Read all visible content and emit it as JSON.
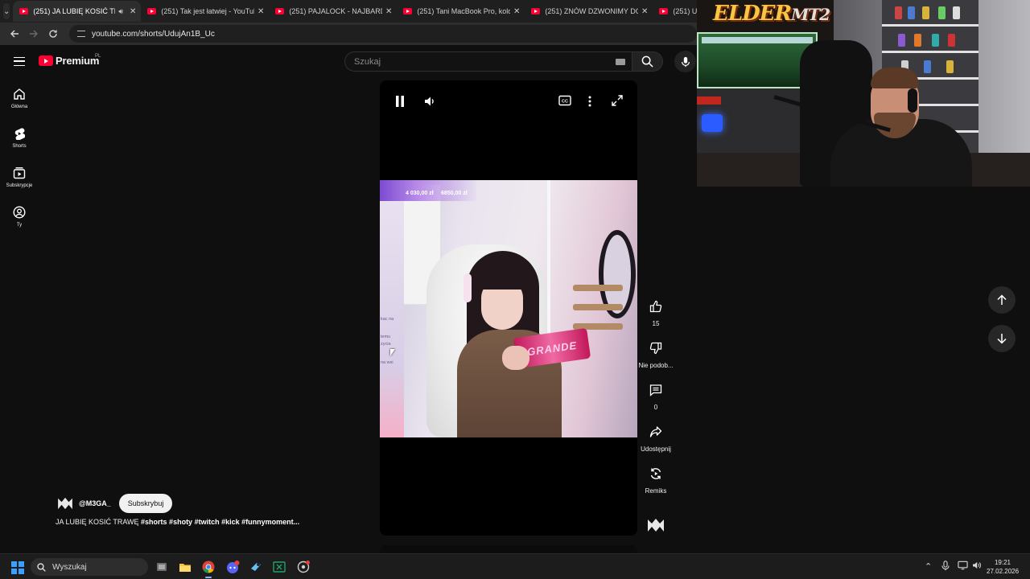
{
  "browser": {
    "tabs": [
      {
        "label": "(251) JA LUBIĘ KOSIĆ TRAWĘ",
        "active": true,
        "audio": true
      },
      {
        "label": "(251) Tak jest łatwiej - YouTube",
        "active": false
      },
      {
        "label": "(251) PAJALOCK - NAJBARDZIE",
        "active": false
      },
      {
        "label": "(251) Tani MacBook Pro, koloro",
        "active": false
      },
      {
        "label": "(251) ZNÓW DZWONIMY DO N",
        "active": false
      },
      {
        "label": "(251) U",
        "active": false
      }
    ],
    "url": "youtube.com/shorts/UdujAn1B_Uc"
  },
  "header": {
    "logo_text": "Premium",
    "region": "PL",
    "search_placeholder": "Szukaj"
  },
  "sidebar": {
    "items": [
      {
        "label": "Główna",
        "icon": "home-icon"
      },
      {
        "label": "Shorts",
        "icon": "shorts-icon"
      },
      {
        "label": "Subskrypcje",
        "icon": "subscriptions-icon"
      },
      {
        "label": "Ty",
        "icon": "account-icon"
      }
    ]
  },
  "video": {
    "overlay_amounts": [
      "4 030,00 zł",
      "6850,00 zł"
    ],
    "chat_lines": [
      "kac na",
      "temu",
      "zycia",
      "na wsi"
    ],
    "product_label": "GRANDE"
  },
  "actions": {
    "likes": "15",
    "dislike_label": "Nie podob...",
    "comments": "0",
    "share_label": "Udostępnij",
    "remix_label": "Remiks"
  },
  "channel": {
    "handle": "@M3GA_",
    "subscribe_label": "Subskrybuj",
    "title_prefix": "JA LUBIĘ KOSIĆ TRAWĘ",
    "hashtags": "#shorts #shoty #twitch #kick #funnymoment..."
  },
  "webcam": {
    "logo_main": "ELDER",
    "logo_suffix": "MT2"
  },
  "taskbar": {
    "search_label": "Wyszukaj",
    "time": "19:21",
    "date": "27.02.2026"
  },
  "colors": {
    "youtube_red": "#ff0033",
    "background": "#0f0f0f",
    "accent_blue": "#3aa0ff"
  }
}
